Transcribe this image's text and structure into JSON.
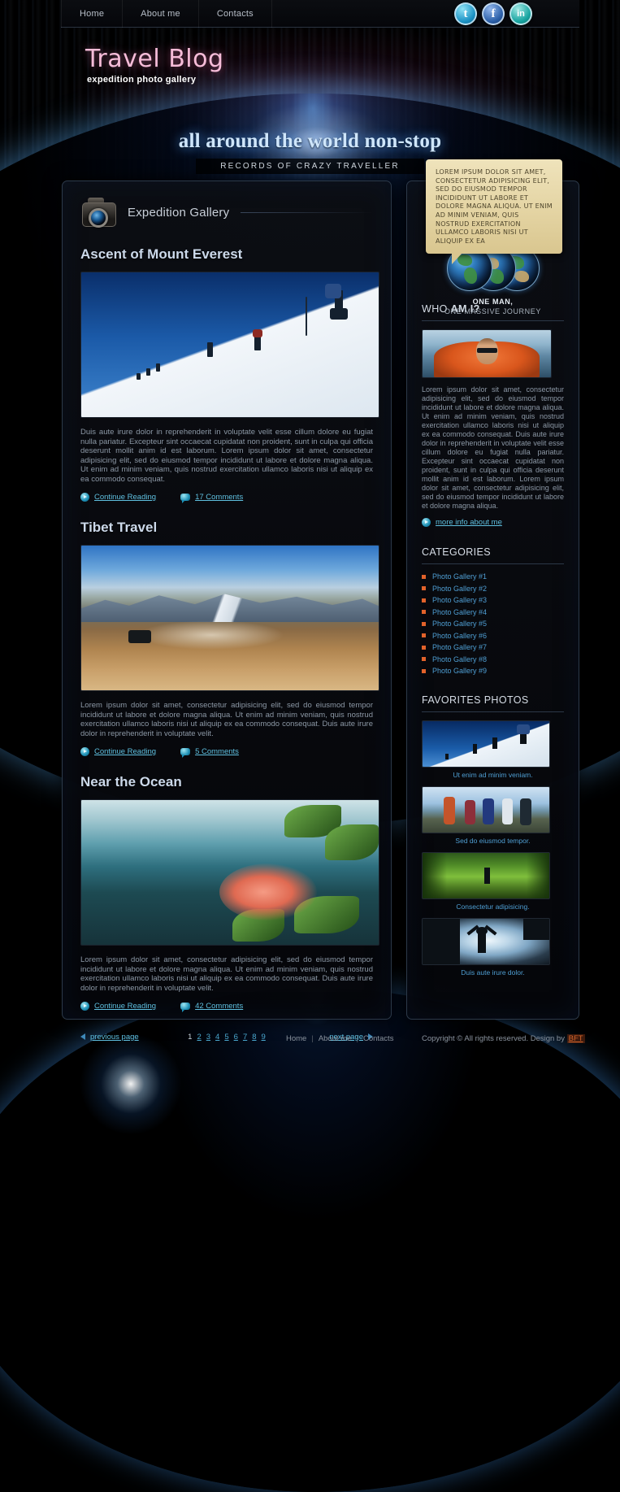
{
  "site": {
    "logo_title": "Travel Blog",
    "logo_subtitle": "expedition photo gallery"
  },
  "nav": {
    "items": [
      {
        "label": "Home"
      },
      {
        "label": "About me"
      },
      {
        "label": "Contacts"
      }
    ]
  },
  "social": {
    "twitter": "t",
    "facebook": "f",
    "linkedin": "in"
  },
  "hero": {
    "title": "all around the world non-stop",
    "subtitle": "RECORDS OF CRAZY TRAVELLER"
  },
  "gallery": {
    "header": "Expedition Gallery",
    "camera_icon": "camera-icon"
  },
  "articles": [
    {
      "title": "Ascent of Mount Everest",
      "body": "Duis aute irure dolor in reprehenderit in voluptate velit esse cillum dolore eu fugiat nulla pariatur. Excepteur sint occaecat cupidatat non proident, sunt in culpa qui officia deserunt mollit anim id est laborum. Lorem ipsum dolor sit amet, consectetur adipisicing elit, sed do eiusmod tempor incididunt ut labore et dolore magna aliqua. Ut enim ad minim veniam, quis nostrud exercitation ullamco laboris nisi ut aliquip ex ea commodo consequat.",
      "continue_label": "Continue Reading",
      "comments_label": "17 Comments"
    },
    {
      "title": "Tibet Travel",
      "body": "Lorem ipsum dolor sit amet, consectetur adipisicing elit, sed do eiusmod tempor incididunt ut labore et dolore magna aliqua. Ut enim ad minim veniam, quis nostrud exercitation ullamco laboris nisi ut aliquip ex ea commodo consequat. Duis aute irure dolor in reprehenderit in voluptate velit.",
      "continue_label": "Continue Reading",
      "comments_label": "5 Comments"
    },
    {
      "title": "Near the Ocean",
      "body": "Lorem ipsum dolor sit amet, consectetur adipisicing elit, sed do eiusmod tempor incididunt ut labore et dolore magna aliqua. Ut enim ad minim veniam, quis nostrud exercitation ullamco laboris nisi ut aliquip ex ea commodo consequat. Duis aute irure dolor in reprehenderit in voluptate velit.",
      "continue_label": "Continue Reading",
      "comments_label": "42 Comments"
    }
  ],
  "pagination": {
    "previous_label": "previous page",
    "next_label": "next page",
    "pages": [
      "1",
      "2",
      "3",
      "4",
      "5",
      "6",
      "7",
      "8",
      "9"
    ],
    "current": "1"
  },
  "sidebar": {
    "bubble_text": "LOREM IPSUM DOLOR SIT AMET, CONSECTETUR ADIPISICING ELIT, SED DO EIUSMOD TEMPOR INCIDIDUNT UT LABORE ET DOLORE MAGNA ALIQUA. UT ENIM AD MINIM VENIAM, QUIS NOSTRUD EXERCITATION ULLAMCO LABORIS NISI UT ALIQUIP EX EA",
    "tagline_line1": "ONE MAN,",
    "tagline_line2": "ONE MASSIVE JOURNEY",
    "who": {
      "heading_light": "WHO ",
      "heading_bold": "AM I?",
      "text": "Lorem ipsum dolor sit amet, consectetur adipisicing elit, sed do eiusmod tempor incididunt ut labore et dolore magna aliqua. Ut enim ad minim veniam, quis nostrud exercitation ullamco laboris nisi ut aliquip ex ea commodo consequat. Duis aute irure dolor in reprehenderit in voluptate velit esse cillum dolore eu fugiat nulla pariatur. Excepteur sint occaecat cupidatat non proident, sunt in culpa qui officia deserunt mollit anim id est laborum. Lorem ipsum dolor sit amet, consectetur adipisicing elit, sed do eiusmod tempor incididunt ut labore et dolore magna aliqua.",
      "more_link": "more info about me"
    },
    "categories": {
      "heading": "CATEGORIES",
      "items": [
        {
          "label": "Photo Gallery #1"
        },
        {
          "label": "Photo Gallery #2"
        },
        {
          "label": "Photo Gallery #3"
        },
        {
          "label": "Photo Gallery #4"
        },
        {
          "label": "Photo Gallery #5"
        },
        {
          "label": "Photo Gallery #6"
        },
        {
          "label": "Photo Gallery #7"
        },
        {
          "label": "Photo Gallery #8"
        },
        {
          "label": "Photo Gallery #9"
        }
      ]
    },
    "favorites": {
      "heading": "FAVORITES PHOTOS",
      "items": [
        {
          "caption": "Ut enim ad minim veniam."
        },
        {
          "caption": "Sed do eiusmod tempor."
        },
        {
          "caption": "Consectetur adipisicing."
        },
        {
          "caption": "Duis aute irure dolor."
        }
      ]
    }
  },
  "footer": {
    "nav": [
      {
        "label": "Home"
      },
      {
        "label": "About me"
      },
      {
        "label": "Contacts"
      }
    ],
    "separator": "|",
    "copyright": "Copyright © All rights reserved. Design by ",
    "design_by": "BFT"
  },
  "colors": {
    "accent_pink": "#f5bcd8",
    "accent_blue": "#5fc0e0",
    "accent_orange": "#e2622a",
    "panel_bg": "#0b0d12",
    "panel_border": "#2d3a4a"
  }
}
